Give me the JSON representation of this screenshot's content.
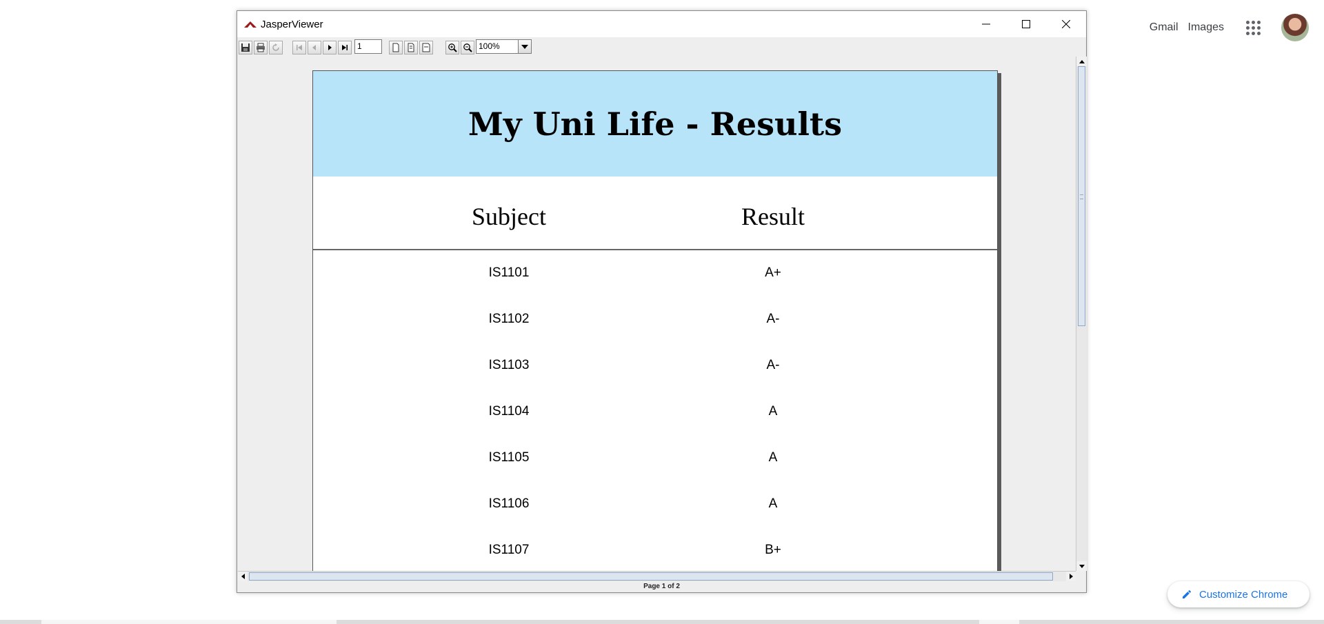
{
  "chrome": {
    "gmail_label": "Gmail",
    "images_label": "Images",
    "customize_label": "Customize Chrome",
    "accent_color": "#1a73e8"
  },
  "window": {
    "title": "JasperViewer",
    "icons": {
      "minimize": "minimize-icon",
      "maximize": "maximize-icon",
      "close": "close-icon"
    }
  },
  "toolbar": {
    "page_number": "1",
    "zoom_value": "100%",
    "icons": [
      "save-icon",
      "print-icon",
      "reload-icon",
      "first-page-icon",
      "previous-page-icon",
      "next-page-icon",
      "last-page-icon",
      "actual-size-icon",
      "fit-page-icon",
      "fit-width-icon",
      "zoom-in-icon",
      "zoom-out-icon",
      "dropdown-arrow-icon"
    ]
  },
  "report": {
    "title": "My Uni Life - Results",
    "header_bg": "#b8e4fa",
    "columns": [
      "Subject",
      "Result"
    ],
    "rows": [
      {
        "subject": "IS1101",
        "result": "A+"
      },
      {
        "subject": "IS1102",
        "result": "A-"
      },
      {
        "subject": "IS1103",
        "result": "A-"
      },
      {
        "subject": "IS1104",
        "result": "A"
      },
      {
        "subject": "IS1105",
        "result": "A"
      },
      {
        "subject": "IS1106",
        "result": "A"
      },
      {
        "subject": "IS1107",
        "result": "B+"
      }
    ]
  },
  "status": {
    "page_info": "Page 1 of 2"
  }
}
